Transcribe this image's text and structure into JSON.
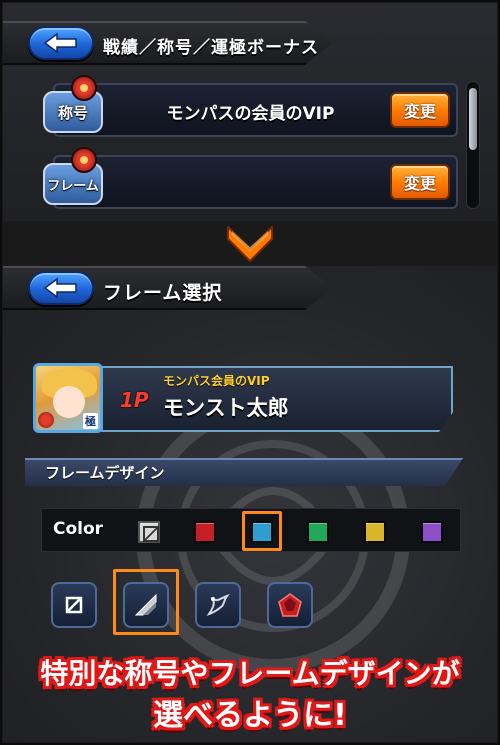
{
  "panel1": {
    "header_title": "戦績／称号／運極ボーナス",
    "rows": [
      {
        "tag": "称号",
        "value": "モンパスの会員のVIP",
        "button": "変更"
      },
      {
        "tag": "フレーム",
        "value": "",
        "button": "変更"
      }
    ]
  },
  "panel2": {
    "header_title": "フレーム選択",
    "profile": {
      "title": "モンパス会員のVIP",
      "player_tag": "1P",
      "name": "モンスト太郎",
      "avatar_badge": "極"
    },
    "section_label": "フレームデザイン",
    "color_label": "Color",
    "colors": [
      "none",
      "#c41f26",
      "#2c9ed1",
      "#22a85a",
      "#d8b52a",
      "#8a4fc9"
    ],
    "selected_color_index": 2,
    "designs": [
      "square-frame",
      "corner-frame",
      "ornate-frame",
      "red-gem-frame"
    ],
    "selected_design_index": 1
  },
  "caption": {
    "line1": "特別な称号やフレームデザインが",
    "line2": "選べるように!"
  }
}
